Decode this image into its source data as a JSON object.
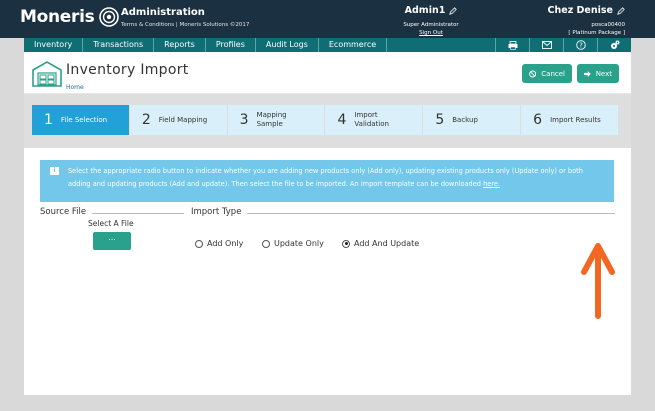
{
  "header": {
    "logo": "Moneris",
    "title": "Administration",
    "subtitle": "Terms & Conditions | Moneris Solutions ©2017",
    "user_name": "Admin1",
    "user_role": "Super Administrator",
    "sign_out": "Sign Out",
    "store_name": "Chez Denise",
    "store_id": "posca00400",
    "store_package": "[ Platinum Package ]"
  },
  "nav": {
    "items": [
      "Inventory",
      "Transactions",
      "Reports",
      "Profiles",
      "Audit Logs",
      "Ecommerce"
    ],
    "icons": [
      "printer-icon",
      "mail-icon",
      "help-icon",
      "settings-icon"
    ]
  },
  "page": {
    "title": "Inventory Import",
    "breadcrumb": "Home",
    "cancel_label": "Cancel",
    "next_label": "Next"
  },
  "steps": [
    {
      "num": "1",
      "label": "File Selection"
    },
    {
      "num": "2",
      "label": "Field Mapping"
    },
    {
      "num": "3",
      "label": "Mapping Sample"
    },
    {
      "num": "4",
      "label": "Import Validation"
    },
    {
      "num": "5",
      "label": "Backup"
    },
    {
      "num": "6",
      "label": "Import Results"
    }
  ],
  "info": {
    "text": "Select the appropriate radio button to indicate whether you are adding new products only (Add only), updating existing products only (Update only) or both adding and updating products (Add and update). Then select the file to be imported. An import template can be downloaded ",
    "link": "here."
  },
  "form": {
    "source_label": "Source File",
    "select_label": "Select A File",
    "file_button": "...",
    "import_type_label": "Import Type",
    "options": [
      "Add Only",
      "Update Only",
      "Add And Update"
    ],
    "selected": "Add And Update"
  },
  "colors": {
    "header_bg": "#1b3142",
    "nav_bg": "#0e6e73",
    "accent_green": "#2aa18a",
    "step_active": "#21a1d8",
    "info_bg": "#72c7ea",
    "arrow": "#f26722"
  }
}
